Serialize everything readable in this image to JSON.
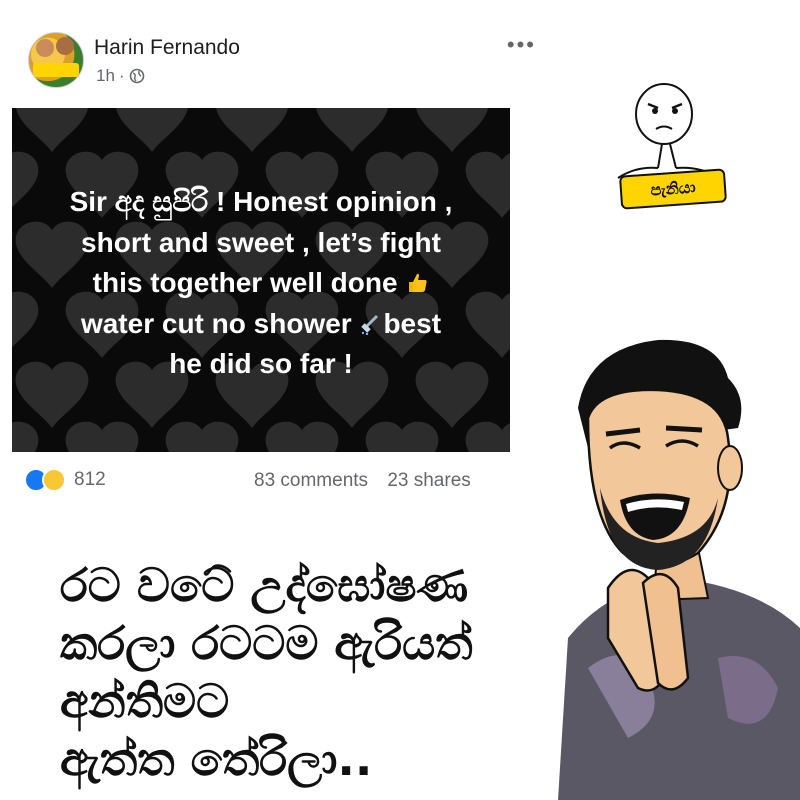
{
  "post": {
    "author": "Harin Fernando",
    "time": "1h",
    "meta_separator": "·",
    "more_icon": "more-horizontal-icon",
    "card_lines": [
      "Sir අද සුපිරි ! Honest opinion ,",
      "short and sweet , let’s fight",
      "this together well done",
      "water cut no shower",
      "best",
      "he did so far !"
    ],
    "reaction_icons": [
      "like-icon",
      "haha-icon"
    ],
    "reaction_count": "812",
    "comments": "83 comments",
    "shares": "23 shares"
  },
  "meme": {
    "badge": "පැනියා",
    "caption_lines": [
      "රට වටේ උද්ඝෝෂණ",
      "කරලා රටටම ඇරියත්",
      "අන්තිමට",
      "ඇත්ත තේරිලා.."
    ]
  },
  "colors": {
    "card_background": "#0a0a0a",
    "like_blue": "#1877f2",
    "badge_yellow": "#ffd400",
    "meta_gray": "#65676b"
  }
}
